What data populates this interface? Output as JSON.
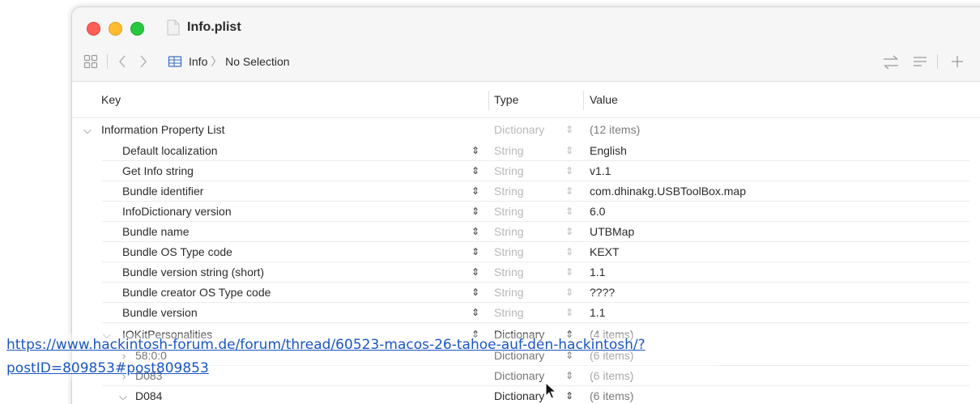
{
  "window": {
    "title": "Info.plist"
  },
  "toolbar": {
    "grid_icon": "grid-icon",
    "back_icon": "chevron-left-icon",
    "forward_icon": "chevron-right-icon",
    "breadcrumb_root": "Info",
    "breadcrumb_sep": "〉",
    "breadcrumb_current": "No Selection",
    "swap_icon": "arrows-swap-icon",
    "lines_icon": "lines-icon",
    "add_icon": "plus-icon"
  },
  "columns": {
    "key": "Key",
    "type": "Type",
    "value": "Value"
  },
  "root": {
    "key": "Information Property List",
    "type": "Dictionary",
    "value": "(12 items)"
  },
  "entries": [
    {
      "key": "Default localization",
      "type": "String",
      "value": "English"
    },
    {
      "key": "Get Info string",
      "type": "String",
      "value": "v1.1"
    },
    {
      "key": "Bundle identifier",
      "type": "String",
      "value": "com.dhinakg.USBToolBox.map"
    },
    {
      "key": "InfoDictionary version",
      "type": "String",
      "value": "6.0"
    },
    {
      "key": "Bundle name",
      "type": "String",
      "value": "UTBMap"
    },
    {
      "key": "Bundle OS Type code",
      "type": "String",
      "value": "KEXT"
    },
    {
      "key": "Bundle version string (short)",
      "type": "String",
      "value": "1.1"
    },
    {
      "key": "Bundle creator OS Type code",
      "type": "String",
      "value": "????"
    },
    {
      "key": "Bundle version",
      "type": "String",
      "value": "1.1"
    }
  ],
  "iokit": {
    "key": "IOKitPersonalities",
    "type": "Dictionary",
    "value": "(4 items)"
  },
  "iokit_children": [
    {
      "key": "58:0:0",
      "type": "Dictionary",
      "value": "(6 items)"
    },
    {
      "key": "D083",
      "type": "Dictionary",
      "value": "(6 items)"
    },
    {
      "key": "D084",
      "type": "Dictionary",
      "value": "(6 items)"
    }
  ],
  "overlay_link": {
    "text": "https://www.hackintosh-forum.de/forum/thread/60523-macos-26-tahoe-auf-den-hackintosh/?postID=809853#post809853"
  },
  "colors": {
    "close": "#ff5f57",
    "minimize": "#febc2e",
    "maximize": "#28c840",
    "link": "#1a56c4"
  }
}
